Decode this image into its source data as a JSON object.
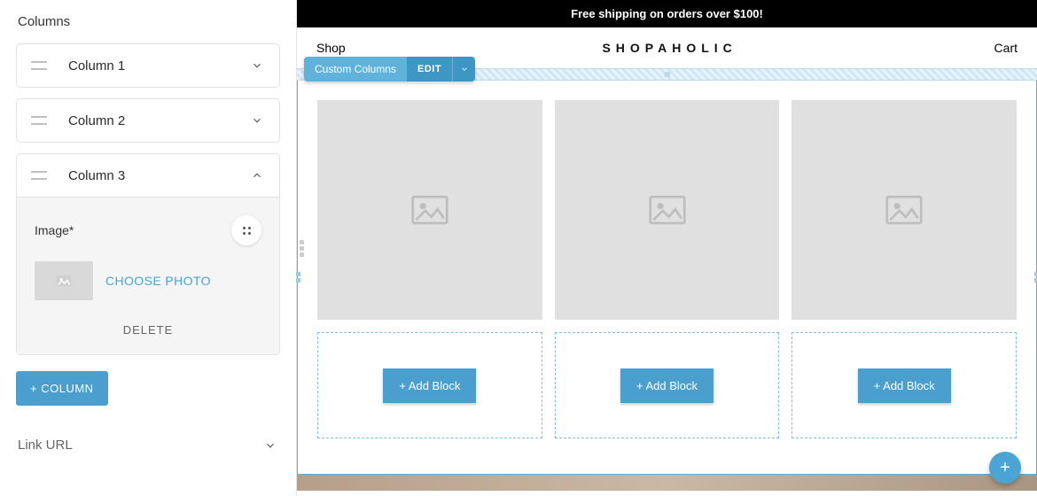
{
  "sidebar": {
    "heading": "Columns",
    "columns": [
      {
        "title": "Column 1",
        "expanded": false
      },
      {
        "title": "Column 2",
        "expanded": false
      },
      {
        "title": "Column 3",
        "expanded": true
      }
    ],
    "image_field_label": "Image*",
    "choose_photo": "CHOOSE PHOTO",
    "delete_label": "DELETE",
    "add_column": "+ COLUMN",
    "link_url_label": "Link URL"
  },
  "canvas": {
    "announcement": "Free shipping on orders over $100!",
    "nav_left": "Shop",
    "logo": "SHOPAHOLIC",
    "nav_right": "Cart",
    "tag_label": "Custom Columns",
    "tag_edit": "EDIT",
    "add_block": "+ Add Block",
    "fab": "+"
  },
  "colors": {
    "accent": "#4a9fcf"
  }
}
